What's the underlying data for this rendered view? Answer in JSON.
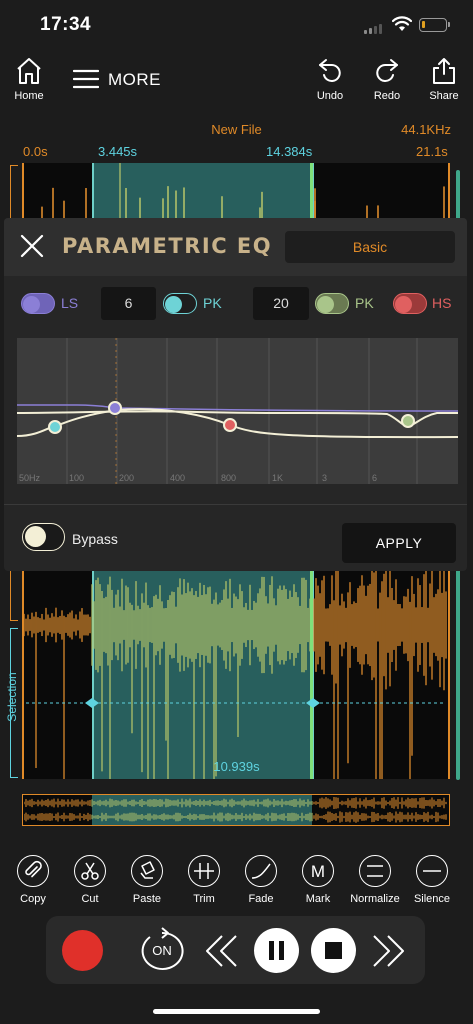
{
  "status": {
    "time": "17:34"
  },
  "toolbar": {
    "home_label": "Home",
    "more_label": "MORE",
    "undo_label": "Undo",
    "redo_label": "Redo",
    "share_label": "Share"
  },
  "file": {
    "name": "New File",
    "sample_rate": "44.1KHz",
    "time_start": "0.0s",
    "sel_start": "3.445s",
    "sel_end": "14.384s",
    "time_end": "21.1s",
    "selection_label": "Selection",
    "selection_duration": "10.939s"
  },
  "eq": {
    "title": "PARAMETRIC EQ",
    "mode": "Basic",
    "bands": [
      {
        "type": "LS",
        "color": "#8b7fd6"
      },
      {
        "type": "PK",
        "color": "#6ed3d6",
        "value_before": "6"
      },
      {
        "type": "PK",
        "color": "#a9c58a",
        "value_before": "20"
      },
      {
        "type": "HS",
        "color": "#e06060"
      }
    ],
    "freq_labels": [
      "50Hz",
      "100",
      "200",
      "400",
      "800",
      "1K",
      "3",
      "6"
    ],
    "bypass_label": "Bypass",
    "apply_label": "APPLY"
  },
  "tools": [
    {
      "label": "Copy",
      "icon": "paperclip-icon"
    },
    {
      "label": "Cut",
      "icon": "scissors-icon"
    },
    {
      "label": "Paste",
      "icon": "paste-icon"
    },
    {
      "label": "Trim",
      "icon": "trim-icon"
    },
    {
      "label": "Fade",
      "icon": "fade-icon"
    },
    {
      "label": "Mark",
      "icon": "mark-icon"
    },
    {
      "label": "Normalize",
      "icon": "normalize-icon"
    },
    {
      "label": "Silence",
      "icon": "silence-icon"
    }
  ],
  "transport": {
    "loop_label": "ON",
    "colors": {
      "record": "#e0302a"
    }
  },
  "colors": {
    "accent": "#e08a28",
    "selection": "#5ed3e0",
    "wave_orange": "#e8922e",
    "wave_green": "#b9c76a"
  }
}
